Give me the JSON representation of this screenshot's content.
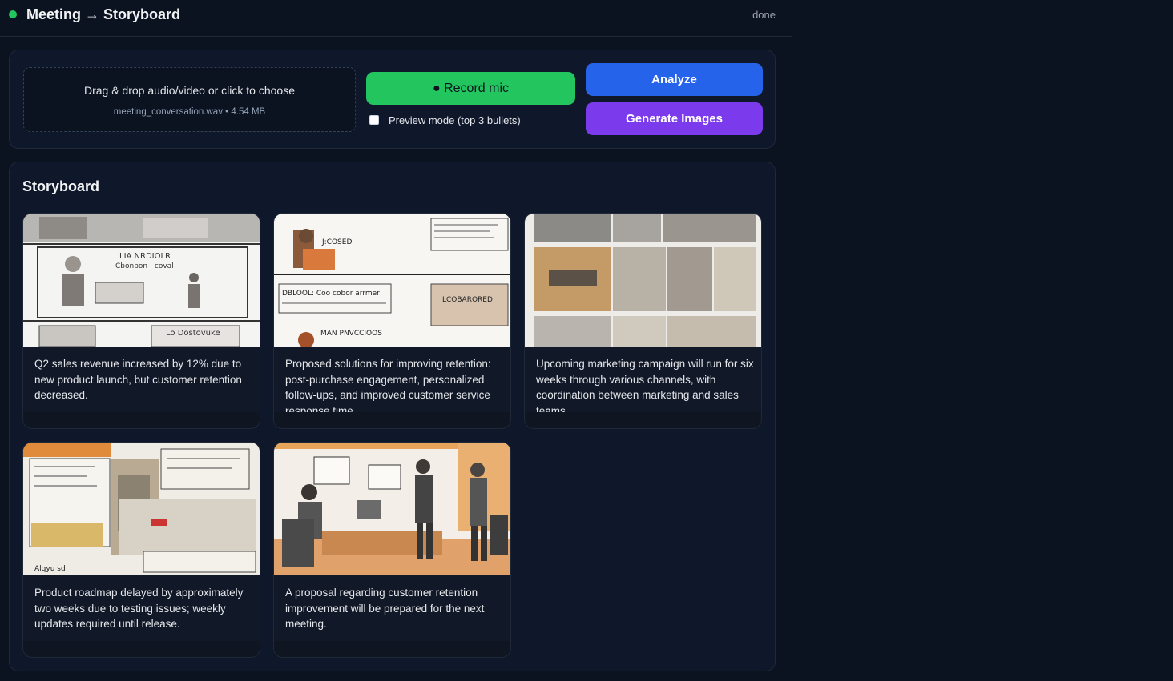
{
  "header": {
    "title": "Meeting → Storyboard",
    "status": "done",
    "status_color": "#22c55e"
  },
  "upload": {
    "dropzone_label": "Drag & drop audio/video or click to choose",
    "file_info": "meeting_conversation.wav • 4.54 MB"
  },
  "controls": {
    "record_label": "● Record mic",
    "preview_label": "Preview mode (top 3 bullets)",
    "preview_checked": false,
    "analyze_label": "Analyze",
    "generate_label": "Generate Images"
  },
  "colors": {
    "record": "#22c55e",
    "analyze": "#2563eb",
    "generate": "#7c3aed"
  },
  "storyboard": {
    "title": "Storyboard",
    "cards": [
      {
        "image": "sketch-meeting-illustration",
        "text": "Q2 sales revenue increased by 12% due to new product launch, but customer retention decreased."
      },
      {
        "image": "sketch-document-illustration",
        "text": "Proposed solutions for improving retention: post-purchase engagement, personalized follow-ups, and improved customer service response time."
      },
      {
        "image": "office-photo-collage",
        "text": "Upcoming marketing campaign will run for six weeks through various channels, with coordination between marketing and sales teams."
      },
      {
        "image": "street-sketch-collage",
        "text": "Product roadmap delayed by approximately two weeks due to testing issues; weekly updates required until release."
      },
      {
        "image": "office-handshake-illustration",
        "text": "A proposal regarding customer retention improvement will be prepared for the next meeting."
      }
    ]
  }
}
